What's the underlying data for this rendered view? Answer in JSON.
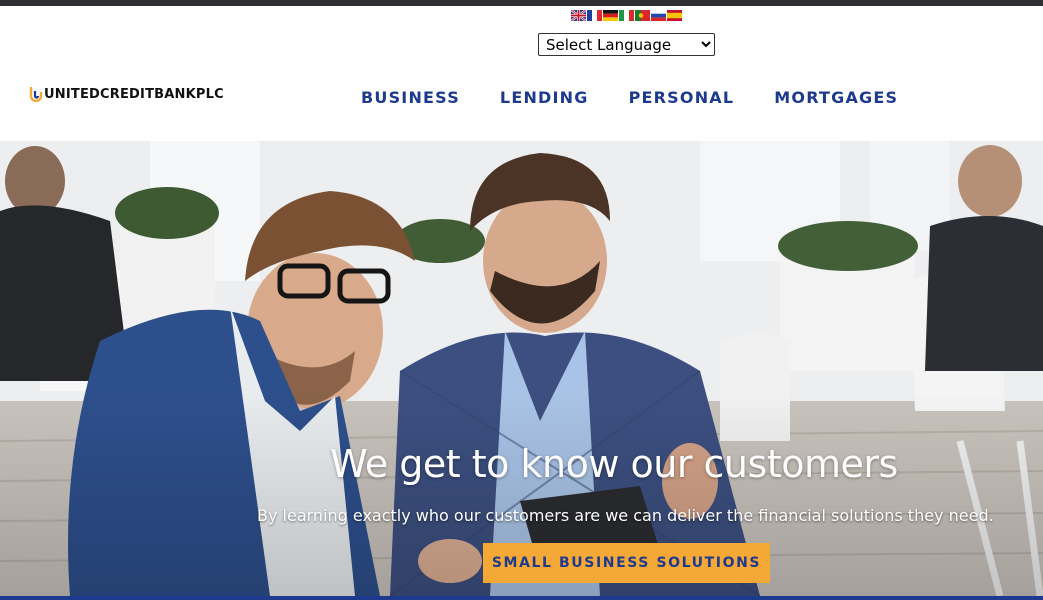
{
  "language": {
    "flags": [
      {
        "name": "english-flag-icon",
        "label": "English"
      },
      {
        "name": "french-flag-icon",
        "label": "French"
      },
      {
        "name": "german-flag-icon",
        "label": "German"
      },
      {
        "name": "italian-flag-icon",
        "label": "Italian"
      },
      {
        "name": "portuguese-flag-icon",
        "label": "Portuguese"
      },
      {
        "name": "russian-flag-icon",
        "label": "Russian"
      },
      {
        "name": "spanish-flag-icon",
        "label": "Spanish"
      }
    ],
    "select_value": "Select Language"
  },
  "brand": {
    "name": "UNITEDCREDITBANKPLC",
    "mark_color": "#f4a836"
  },
  "nav": {
    "items": [
      "BUSINESS",
      "LENDING",
      "PERSONAL",
      "MORTGAGES"
    ],
    "color": "#1e3a8f"
  },
  "hero": {
    "title": "We get to know our customers",
    "subtitle": "By learning exactly who our customers are we can deliver the financial solutions they need.",
    "cta_label": "SMALL BUSINESS SOLUTIONS",
    "cta_color": "#f4a836"
  }
}
